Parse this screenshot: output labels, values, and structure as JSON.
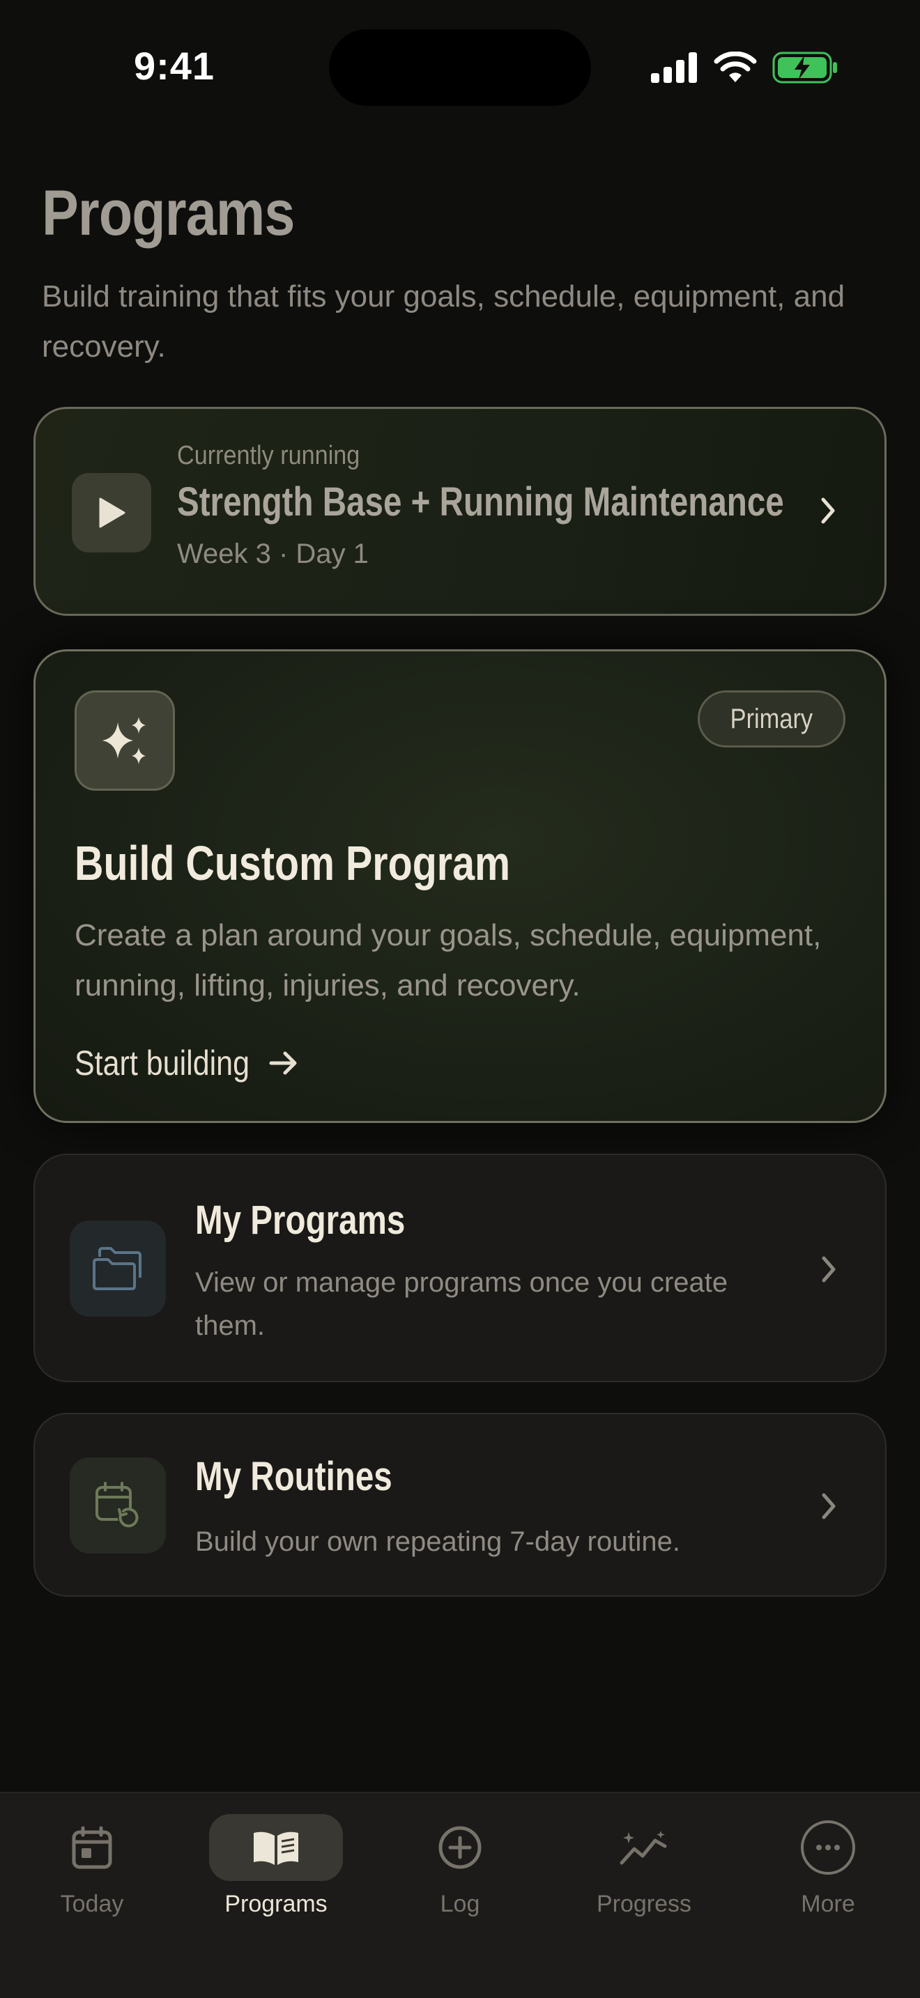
{
  "status": {
    "time": "9:41"
  },
  "page": {
    "title": "Programs",
    "subtitle": "Build training that fits your goals, schedule, equipment, and recovery."
  },
  "current": {
    "label": "Currently running",
    "title": "Strength Base + Running Maintenance",
    "subtitle": "Week 3 · Day 1"
  },
  "build": {
    "badge": "Primary",
    "title": "Build Custom Program",
    "description": "Create a plan around your goals, schedule, equipment, running, lifting, injuries, and recovery.",
    "cta": "Start building"
  },
  "my_programs": {
    "title": "My Programs",
    "description": "View or manage programs once you create them."
  },
  "my_routines": {
    "title": "My Routines",
    "description": "Build your own repeating 7-day routine."
  },
  "tabs": [
    {
      "label": "Today",
      "icon": "calendar-icon"
    },
    {
      "label": "Programs",
      "icon": "book-icon",
      "active": true
    },
    {
      "label": "Log",
      "icon": "plus-circle-icon"
    },
    {
      "label": "Progress",
      "icon": "trend-icon"
    },
    {
      "label": "More",
      "icon": "more-icon"
    }
  ],
  "colors": {
    "background": "#0e0e0d",
    "card_green": "#1b2116",
    "battery_green": "#3fc25a",
    "text_primary": "#f0eadd",
    "text_muted": "#8e8a82"
  }
}
